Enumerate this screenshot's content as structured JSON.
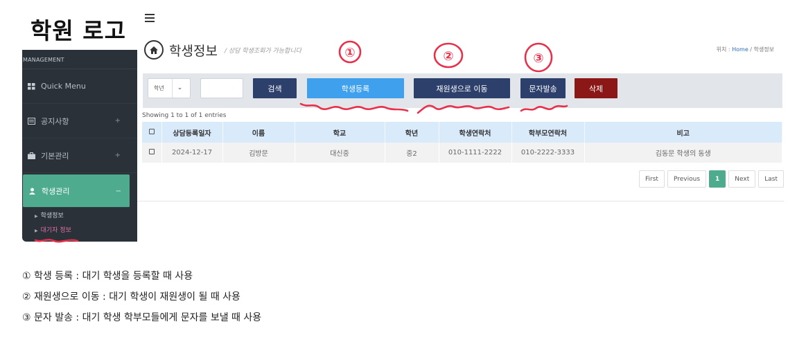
{
  "logo": "학원 로고",
  "sidebar": {
    "header": "MANAGEMENT",
    "items": [
      {
        "label": "Quick Menu",
        "plus": ""
      },
      {
        "label": "공지사항",
        "plus": "+"
      },
      {
        "label": "기본관리",
        "plus": "+"
      },
      {
        "label": "학생관리",
        "plus": "−"
      }
    ],
    "subitems": [
      "학생정보",
      "대기자 정보"
    ]
  },
  "header": {
    "title": "학생정보",
    "subtitle": "/ 상담 학생조회가 가능합니다",
    "breadcrumb_prefix": "위치 :",
    "breadcrumb_home": "Home",
    "breadcrumb_sep": "/",
    "breadcrumb_current": "학생정보"
  },
  "toolbar": {
    "select_value": "학년",
    "search_label": "검색",
    "register_label": "학생등록",
    "move_label": "재원생으로 이동",
    "sms_label": "문자발송",
    "delete_label": "삭제"
  },
  "table": {
    "showing": "Showing 1 to 1 of 1 entries",
    "columns": [
      "상담등록일자",
      "이름",
      "학교",
      "학년",
      "학생연락처",
      "학부모연락처",
      "비고"
    ],
    "rows": [
      [
        "2024-12-17",
        "김방문",
        "대신중",
        "중2",
        "010-1111-2222",
        "010-2222-3333",
        "김동문 학생의 동생"
      ]
    ]
  },
  "pager": {
    "first": "First",
    "previous": "Previous",
    "current": "1",
    "next": "Next",
    "last": "Last"
  },
  "annotations": [
    "①",
    "②",
    "③"
  ],
  "notes": [
    "① 학생 등록 : 대기 학생을 등록할 때 사용",
    "② 재원생으로 이동 : 대기 학생이 재원생이 될 때 사용",
    "③ 문자 발송 : 대기 학생 학부모들에게 문자를 보낼 때 사용"
  ],
  "colors": {
    "sidebar_bg": "#2a3139",
    "active_green": "#4fab8d",
    "btn_navy": "#2d3f6b",
    "btn_blue": "#3fa0ee",
    "btn_red": "#8b1816",
    "annotation_red": "#e8304a",
    "table_head": "#d9eafb"
  }
}
